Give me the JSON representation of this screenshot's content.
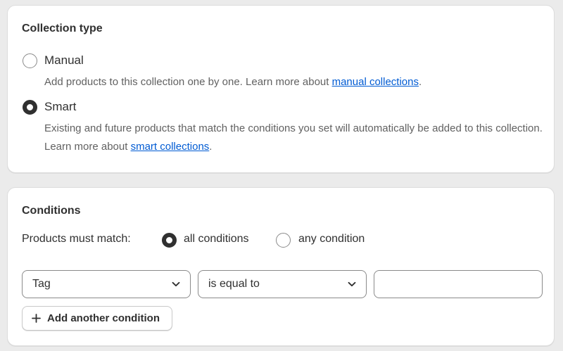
{
  "collection_type": {
    "title": "Collection type",
    "options": [
      {
        "label": "Manual",
        "checked": false,
        "help_text": "Add products to this collection one by one. Learn more about ",
        "link_text": "manual collections",
        "help_suffix": "."
      },
      {
        "label": "Smart",
        "checked": true,
        "help_text": "Existing and future products that match the conditions you set will automatically be added to this collection. Learn more about ",
        "link_text": "smart collections",
        "help_suffix": "."
      }
    ]
  },
  "conditions": {
    "title": "Conditions",
    "match_label": "Products must match:",
    "match_options": [
      {
        "label": "all conditions",
        "checked": true
      },
      {
        "label": "any condition",
        "checked": false
      }
    ],
    "rule": {
      "field": "Tag",
      "operator": "is equal to",
      "value": "",
      "value_placeholder": ""
    },
    "add_button_label": "Add another condition"
  },
  "colors": {
    "link": "#005bd3",
    "text": "#303030",
    "muted_text": "#616161",
    "background": "#ebebeb"
  }
}
